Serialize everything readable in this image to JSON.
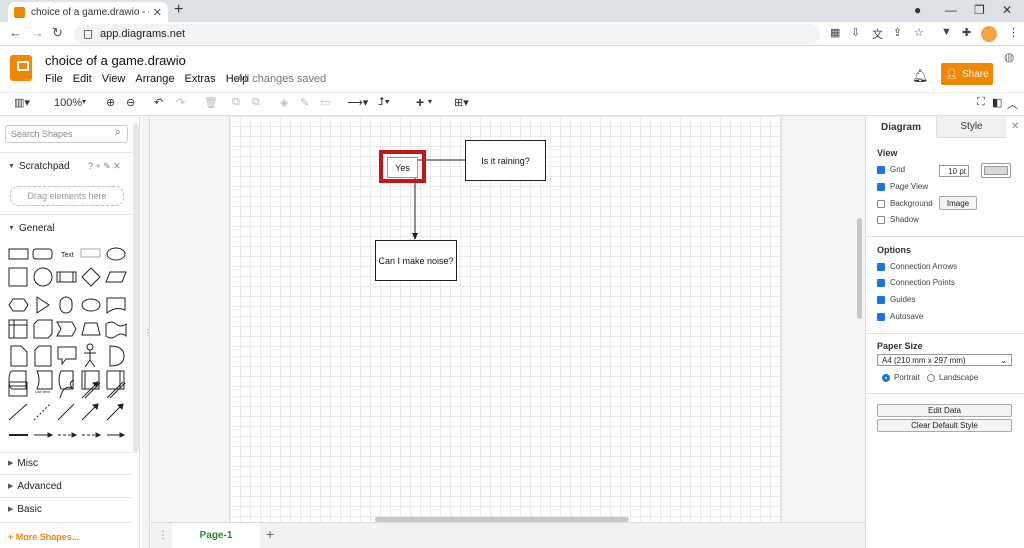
{
  "browser": {
    "tab_title": "choice of a game.drawio - diagra",
    "tab_close": "✕",
    "new_tab": "+",
    "url": "app.diagrams.net"
  },
  "app": {
    "title": "choice of a game.drawio",
    "menu": [
      "File",
      "Edit",
      "View",
      "Arrange",
      "Extras",
      "Help"
    ],
    "save_status": "All changes saved",
    "share_label": "Share",
    "brand_color": "#f08705"
  },
  "toolbar": {
    "zoom": "100%"
  },
  "left_panel": {
    "search_placeholder": "Search Shapes",
    "scratchpad_label": "Scratchpad",
    "scratchpad_icons": "? + ✎ ✕",
    "drag_hint": "Drag elements here",
    "general_label": "General",
    "text_shape_label": "Text",
    "list_item_label": "List Item",
    "sections": [
      "Misc",
      "Advanced",
      "Basic"
    ],
    "more_shapes": "+ More Shapes..."
  },
  "diagram": {
    "nodes": {
      "yes": "Yes",
      "is_it_raining": "Is it raining?",
      "can_i_make_noise": "Can I make noise?"
    },
    "selection_color": "#c0161c"
  },
  "pages": {
    "current": "Page-1"
  },
  "right_panel": {
    "tabs": [
      "Diagram",
      "Style"
    ],
    "view_heading": "View",
    "view_options": [
      {
        "label": "Grid",
        "checked": true
      },
      {
        "label": "Page View",
        "checked": true
      },
      {
        "label": "Background",
        "checked": false
      },
      {
        "label": "Shadow",
        "checked": false
      }
    ],
    "grid_size": "10 pt",
    "image_button": "Image",
    "options_heading": "Options",
    "options": [
      {
        "label": "Connection Arrows",
        "checked": true
      },
      {
        "label": "Connection Points",
        "checked": true
      },
      {
        "label": "Guides",
        "checked": true
      },
      {
        "label": "Autosave",
        "checked": true
      }
    ],
    "paper_size_heading": "Paper Size",
    "paper_size": "A4 (210 mm x 297 mm)",
    "orientation": [
      {
        "label": "Portrait",
        "selected": true
      },
      {
        "label": "Landscape",
        "selected": false
      }
    ],
    "edit_data_button": "Edit Data",
    "clear_style_button": "Clear Default Style"
  }
}
